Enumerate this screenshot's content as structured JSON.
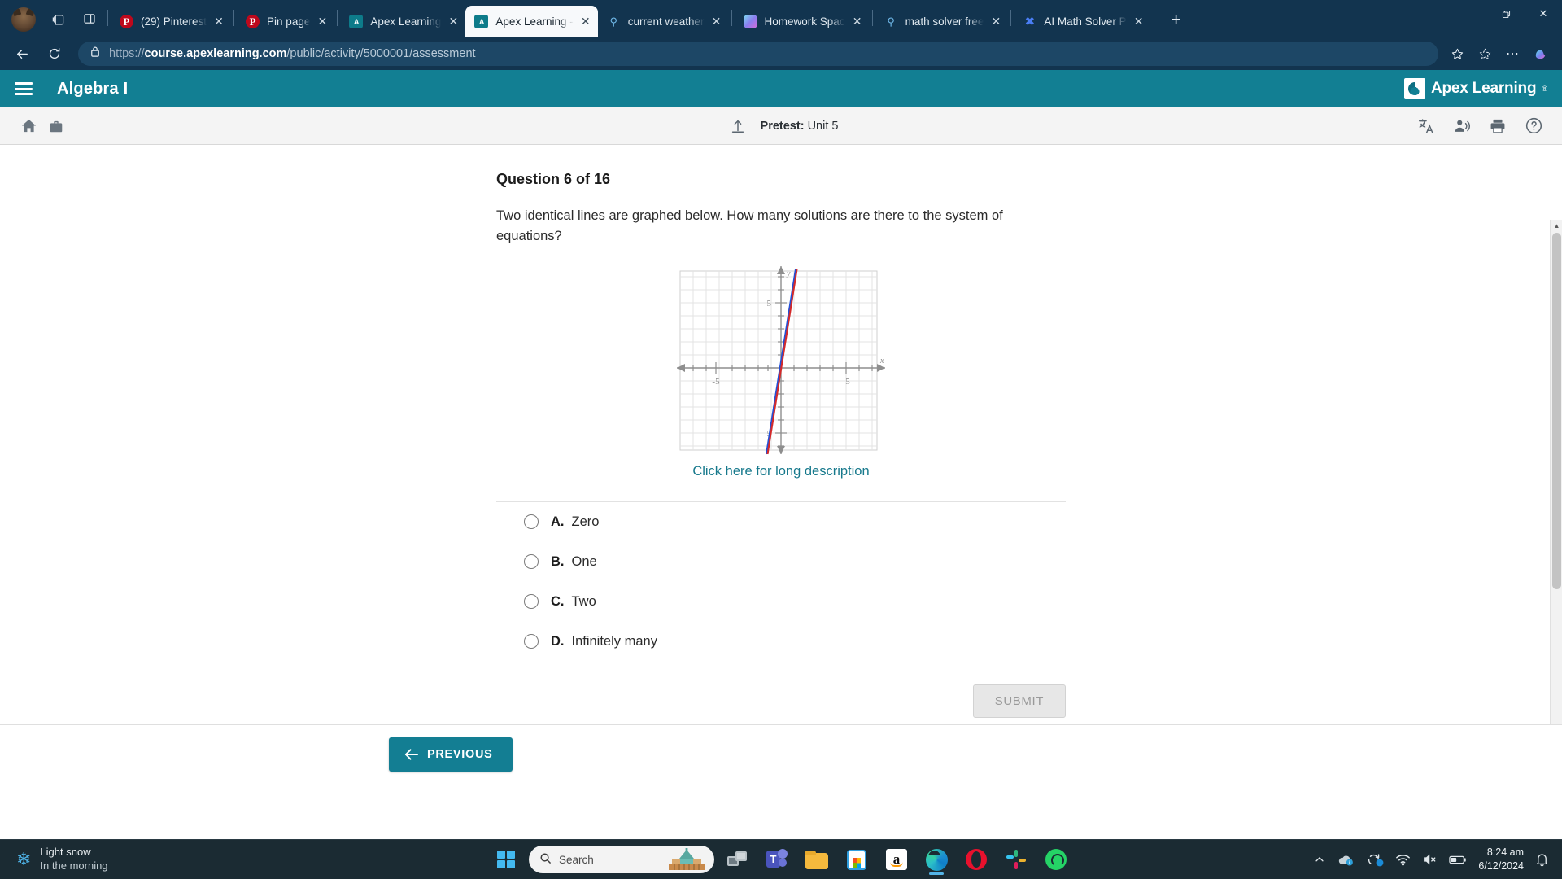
{
  "browser": {
    "tabs": [
      {
        "title": "(29) Pinterest",
        "favicon": "pinterest-icon",
        "active": false
      },
      {
        "title": "Pin page",
        "favicon": "pinterest-icon",
        "active": false
      },
      {
        "title": "Apex Learning",
        "favicon": "apex-icon",
        "active": false
      },
      {
        "title": "Apex Learning -",
        "favicon": "apex-icon",
        "active": true
      },
      {
        "title": "current weather",
        "favicon": "search-icon",
        "active": false
      },
      {
        "title": "Homework Spac",
        "favicon": "copilot-icon",
        "active": false
      },
      {
        "title": "math solver free",
        "favicon": "search-icon",
        "active": false
      },
      {
        "title": "AI Math Solver P",
        "favicon": "x-app-icon",
        "active": false
      }
    ],
    "new_tab_label": "+",
    "window_controls": {
      "minimize": "—",
      "maximize": "❐",
      "close": "✕"
    },
    "url": {
      "scheme": "https://",
      "domain": "course.apexlearning.com",
      "path": "/public/activity/5000001/assessment"
    },
    "toolbar": {
      "back": "back-button",
      "reload": "reload-button",
      "favorite": "favorite-star",
      "collections": "collections-button",
      "settings": "settings-more-button",
      "copilot": "copilot-button"
    }
  },
  "apex": {
    "header": {
      "course_title": "Algebra I",
      "menu_label": "menu",
      "logo_text": "Apex Learning",
      "logo_tm": "®",
      "accent_color": "#127f93"
    },
    "activity_bar": {
      "pretest_label": "Pretest:",
      "pretest_value": "Unit 5",
      "home_icon": "home-icon",
      "briefcase_icon": "briefcase-icon",
      "upload_icon": "upload-icon",
      "translate_icon": "translate-icon",
      "read_aloud_icon": "read-aloud-icon",
      "print_icon": "print-icon",
      "help_icon": "help-icon"
    },
    "question": {
      "heading": "Question 6 of 16",
      "prompt": "Two identical lines are graphed below. How many solutions are there to the system of equations?",
      "long_description_link": "Click here for long description",
      "choices": [
        {
          "letter": "A.",
          "text": "Zero",
          "selected": false
        },
        {
          "letter": "B.",
          "text": "One",
          "selected": false
        },
        {
          "letter": "C.",
          "text": "Two",
          "selected": false
        },
        {
          "letter": "D.",
          "text": "Infinitely many",
          "selected": false
        }
      ],
      "submit_label": "SUBMIT",
      "submit_enabled": false
    },
    "footer": {
      "previous_label": "PREVIOUS"
    }
  },
  "chart_data": {
    "type": "line",
    "title": "",
    "xlabel": "x",
    "ylabel": "y",
    "xlim": [
      -8,
      8
    ],
    "ylim": [
      -8,
      8
    ],
    "grid": true,
    "x_ticks": [
      -5,
      5
    ],
    "y_ticks": [
      5,
      -5
    ],
    "x_tick_labels": [
      "-5",
      "5"
    ],
    "y_tick_labels": [
      "5",
      "-5"
    ],
    "legend": "none",
    "series": [
      {
        "name": "line-1",
        "color": "#1f4fd8",
        "points": [
          [
            -1.1,
            -8
          ],
          [
            1.0,
            8
          ]
        ],
        "slope": 3.8,
        "intercept": 0.2
      },
      {
        "name": "line-2",
        "color": "#d42a2a",
        "points": [
          [
            -1.05,
            -8
          ],
          [
            1.05,
            8
          ]
        ],
        "slope": 3.8,
        "intercept": 0.0
      }
    ],
    "annotation": "Two identical overlapping lines with steep positive slope"
  },
  "taskbar": {
    "weather": {
      "condition": "Light snow",
      "detail": "In the morning",
      "icon": "snowflake-icon"
    },
    "start_label": "start-button",
    "search_placeholder": "Search",
    "apps": [
      {
        "name": "task-view",
        "active": false
      },
      {
        "name": "microsoft-teams",
        "active": false
      },
      {
        "name": "file-explorer",
        "active": false
      },
      {
        "name": "microsoft-store",
        "active": false
      },
      {
        "name": "amazon",
        "active": false
      },
      {
        "name": "microsoft-edge",
        "active": true
      },
      {
        "name": "opera",
        "active": false
      },
      {
        "name": "slack",
        "active": false
      },
      {
        "name": "whatsapp",
        "active": false
      }
    ],
    "tray": {
      "overflow": "show-hidden-icons",
      "onedrive": "onedrive-icon",
      "update": "windows-update-icon",
      "network": "wifi-icon",
      "volume": "volume-muted-icon",
      "battery": "battery-icon",
      "notifications": "notifications-bell-icon"
    },
    "clock": {
      "time": "8:24 am",
      "date": "6/12/2024"
    }
  }
}
